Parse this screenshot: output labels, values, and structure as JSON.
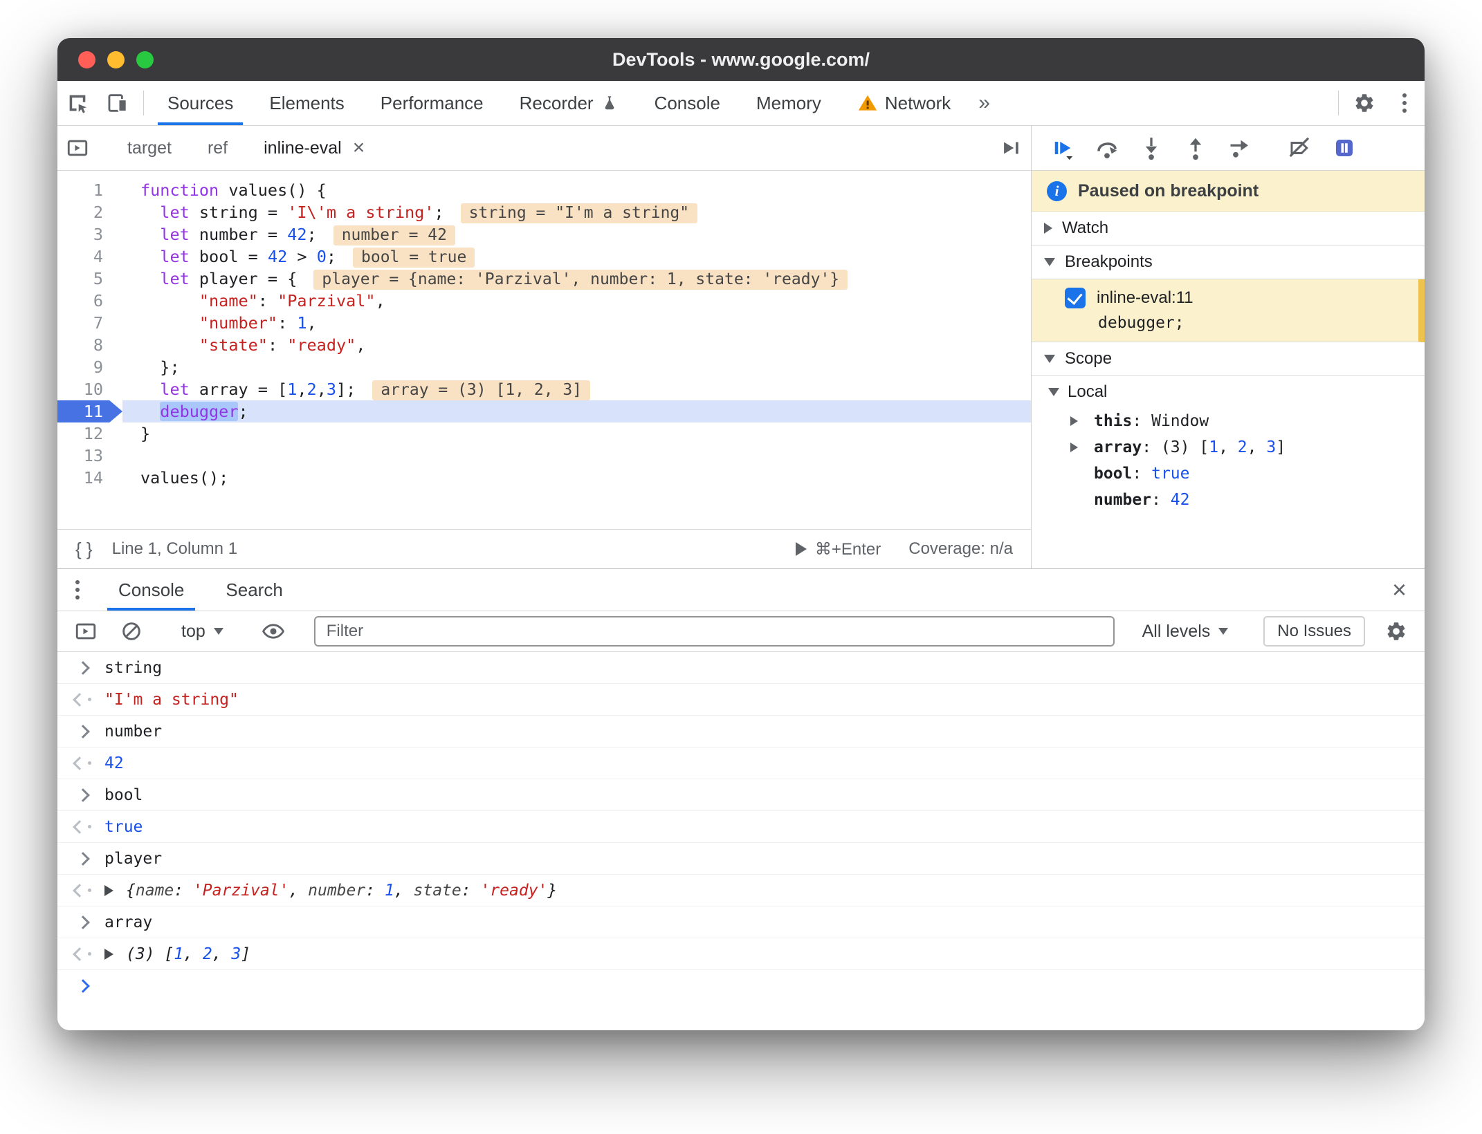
{
  "glyphs": {
    "close": "×",
    "overflow": "»",
    "braces": "{ }"
  },
  "titlebar": {
    "title": "DevTools - www.google.com/"
  },
  "toolbar": {
    "tabs": [
      {
        "label": "Sources"
      },
      {
        "label": "Elements"
      },
      {
        "label": "Performance"
      },
      {
        "label": "Recorder"
      },
      {
        "label": "Console"
      },
      {
        "label": "Memory"
      },
      {
        "label": "Network"
      }
    ]
  },
  "file_tabs": [
    {
      "label": "target"
    },
    {
      "label": "ref"
    },
    {
      "label": "inline-eval"
    }
  ],
  "editor": {
    "lines": [
      {
        "num": "1",
        "tokens": [
          {
            "c": "k",
            "t": "function"
          },
          {
            "t": " values() {"
          }
        ]
      },
      {
        "num": "2",
        "tokens": [
          {
            "t": "  "
          },
          {
            "c": "k",
            "t": "let"
          },
          {
            "t": " string = "
          },
          {
            "c": "s",
            "t": "'I\\'m a string'"
          },
          {
            "t": ";"
          }
        ],
        "widget": "string = \"I'm a string\""
      },
      {
        "num": "3",
        "tokens": [
          {
            "t": "  "
          },
          {
            "c": "k",
            "t": "let"
          },
          {
            "t": " number = "
          },
          {
            "c": "n",
            "t": "42"
          },
          {
            "t": ";"
          }
        ],
        "widget": "number = 42"
      },
      {
        "num": "4",
        "tokens": [
          {
            "t": "  "
          },
          {
            "c": "k",
            "t": "let"
          },
          {
            "t": " bool = "
          },
          {
            "c": "n",
            "t": "42"
          },
          {
            "t": " > "
          },
          {
            "c": "n",
            "t": "0"
          },
          {
            "t": ";"
          }
        ],
        "widget": "bool = true"
      },
      {
        "num": "5",
        "tokens": [
          {
            "t": "  "
          },
          {
            "c": "k",
            "t": "let"
          },
          {
            "t": " player = {"
          }
        ],
        "widget": "player = {name: 'Parzival', number: 1, state: 'ready'}"
      },
      {
        "num": "6",
        "tokens": [
          {
            "t": "      "
          },
          {
            "c": "s",
            "t": "\"name\""
          },
          {
            "t": ": "
          },
          {
            "c": "s",
            "t": "\"Parzival\""
          },
          {
            "t": ","
          }
        ]
      },
      {
        "num": "7",
        "tokens": [
          {
            "t": "      "
          },
          {
            "c": "s",
            "t": "\"number\""
          },
          {
            "t": ": "
          },
          {
            "c": "n",
            "t": "1"
          },
          {
            "t": ","
          }
        ]
      },
      {
        "num": "8",
        "tokens": [
          {
            "t": "      "
          },
          {
            "c": "s",
            "t": "\"state\""
          },
          {
            "t": ": "
          },
          {
            "c": "s",
            "t": "\"ready\""
          },
          {
            "t": ","
          }
        ]
      },
      {
        "num": "9",
        "tokens": [
          {
            "t": "  };"
          }
        ]
      },
      {
        "num": "10",
        "tokens": [
          {
            "t": "  "
          },
          {
            "c": "k",
            "t": "let"
          },
          {
            "t": " array = ["
          },
          {
            "c": "n",
            "t": "1"
          },
          {
            "t": ","
          },
          {
            "c": "n",
            "t": "2"
          },
          {
            "t": ","
          },
          {
            "c": "n",
            "t": "3"
          },
          {
            "t": "];"
          }
        ],
        "widget": "array = (3) [1, 2, 3]"
      },
      {
        "num": "11",
        "tokens": [
          {
            "t": "  "
          },
          {
            "c": "ksel",
            "t": "debugger"
          },
          {
            "t": ";"
          }
        ]
      },
      {
        "num": "12",
        "tokens": [
          {
            "t": "}"
          }
        ]
      },
      {
        "num": "13",
        "tokens": []
      },
      {
        "num": "14",
        "tokens": [
          {
            "t": "values();"
          }
        ]
      }
    ]
  },
  "statusbar": {
    "position": "Line 1, Column 1",
    "shortcut": "⌘+Enter",
    "coverage": "Coverage: n/a"
  },
  "debugger": {
    "paused": "Paused on breakpoint",
    "watch_label": "Watch",
    "breakpoints_label": "Breakpoints",
    "breakpoint": {
      "location": "inline-eval:11",
      "code": "debugger;"
    },
    "scope_label": "Scope",
    "local_label": "Local",
    "scope_rows": [
      {
        "tokens": [
          {
            "c": "nm",
            "t": "this"
          },
          {
            "t": ": "
          },
          {
            "t": "Window"
          }
        ]
      },
      {
        "tokens": [
          {
            "c": "nm",
            "t": "array"
          },
          {
            "t": ": "
          },
          {
            "c": "pv",
            "t": "(3) "
          },
          {
            "t": "["
          },
          {
            "c": "n",
            "t": "1"
          },
          {
            "t": ", "
          },
          {
            "c": "n",
            "t": "2"
          },
          {
            "t": ", "
          },
          {
            "c": "n",
            "t": "3"
          },
          {
            "t": "]"
          }
        ]
      },
      {
        "tokens": [
          {
            "c": "nm",
            "t": "bool"
          },
          {
            "t": ": "
          },
          {
            "c": "n",
            "t": "true"
          }
        ]
      },
      {
        "tokens": [
          {
            "c": "nm",
            "t": "number"
          },
          {
            "t": ": "
          },
          {
            "c": "n",
            "t": "42"
          }
        ]
      }
    ]
  },
  "console": {
    "tabs": [
      {
        "label": "Console"
      },
      {
        "label": "Search"
      }
    ],
    "context": "top",
    "filter_placeholder": "Filter",
    "levels": "All levels",
    "issues": "No Issues",
    "rows": [
      {
        "tokens": [
          {
            "t": "string"
          }
        ]
      },
      {
        "tokens": [
          {
            "c": "s",
            "t": "\"I'm a string\""
          }
        ]
      },
      {
        "tokens": [
          {
            "t": "number"
          }
        ]
      },
      {
        "tokens": [
          {
            "c": "n",
            "t": "42"
          }
        ]
      },
      {
        "tokens": [
          {
            "t": "bool"
          }
        ]
      },
      {
        "tokens": [
          {
            "c": "n",
            "t": "true"
          }
        ]
      },
      {
        "tokens": [
          {
            "t": "player"
          }
        ]
      },
      {
        "tokens": [
          {
            "t": "{"
          },
          {
            "c": "pk",
            "t": "name"
          },
          {
            "t": ": "
          },
          {
            "c": "s",
            "t": "'Parzival'"
          },
          {
            "t": ", "
          },
          {
            "c": "pk",
            "t": "number"
          },
          {
            "t": ": "
          },
          {
            "c": "n",
            "t": "1"
          },
          {
            "t": ", "
          },
          {
            "c": "pk",
            "t": "state"
          },
          {
            "t": ": "
          },
          {
            "c": "s",
            "t": "'ready'"
          },
          {
            "t": "}"
          }
        ]
      },
      {
        "tokens": [
          {
            "t": "array"
          }
        ]
      },
      {
        "tokens": [
          {
            "c": "pv",
            "t": "(3) "
          },
          {
            "t": "["
          },
          {
            "c": "n",
            "t": "1"
          },
          {
            "t": ", "
          },
          {
            "c": "n",
            "t": "2"
          },
          {
            "t": ", "
          },
          {
            "c": "n",
            "t": "3"
          },
          {
            "t": "]"
          }
        ]
      }
    ]
  }
}
